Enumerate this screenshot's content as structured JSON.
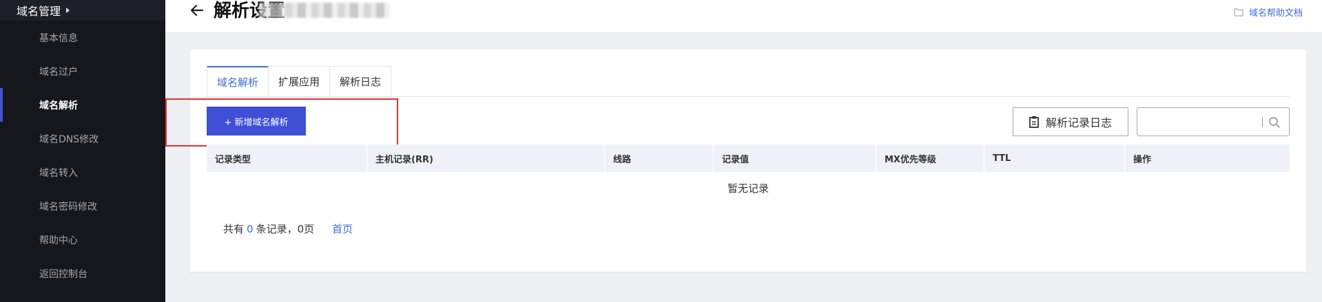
{
  "sidebar": {
    "header": "域名管理",
    "items": [
      {
        "label": "基本信息",
        "active": false
      },
      {
        "label": "域名过户",
        "active": false
      },
      {
        "label": "域名解析",
        "active": true
      },
      {
        "label": "域名DNS修改",
        "active": false
      },
      {
        "label": "域名转入",
        "active": false
      },
      {
        "label": "域名密码修改",
        "active": false
      },
      {
        "label": "帮助中心",
        "active": false
      },
      {
        "label": "返回控制台",
        "active": false
      }
    ]
  },
  "header": {
    "title": "解析设置",
    "help_link": "域名帮助文档"
  },
  "tabs": [
    {
      "label": "域名解析",
      "active": true
    },
    {
      "label": "扩展应用",
      "active": false
    },
    {
      "label": "解析日志",
      "active": false
    }
  ],
  "toolbar": {
    "add_label": "+ 新增域名解析",
    "log_label": "解析记录日志",
    "search_placeholder": ""
  },
  "table": {
    "columns": [
      "记录类型",
      "主机记录(RR)",
      "线路",
      "记录值",
      "MX优先等级",
      "TTL",
      "操作"
    ],
    "empty_text": "暂无记录"
  },
  "pagination": {
    "prefix": "共有",
    "count": "0",
    "suffix": "条记录，0页",
    "first_page": "首页"
  },
  "colors": {
    "primary": "#3f4fd6",
    "link": "#3d6ed6",
    "highlight": "#e5322d",
    "sidebar_bg": "#1e2028"
  }
}
